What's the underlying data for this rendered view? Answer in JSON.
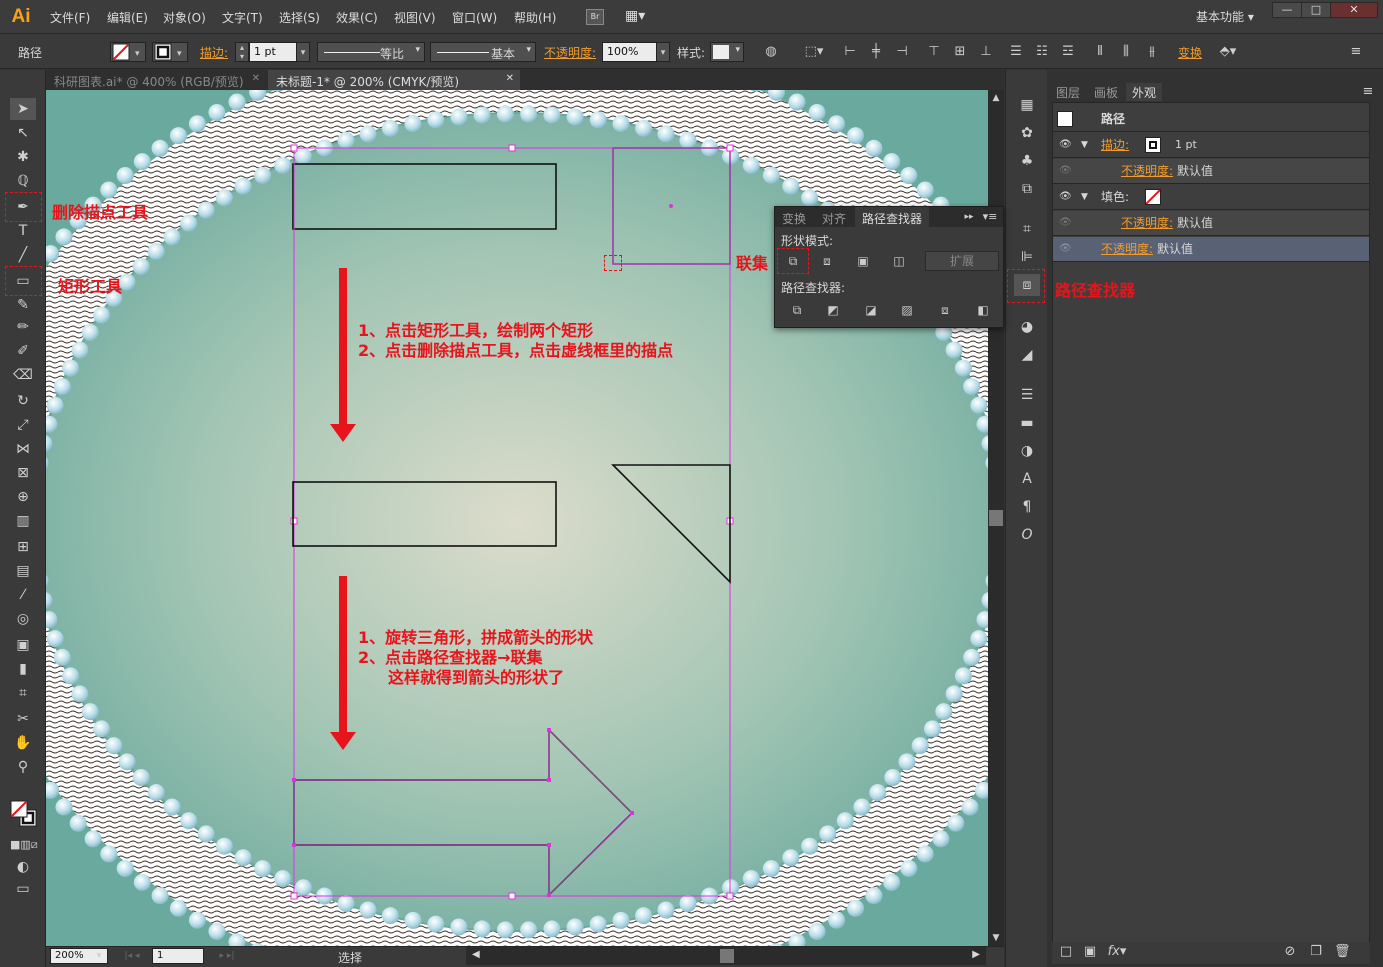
{
  "app": {
    "logo": "Ai",
    "bridge": "Br",
    "workspace": "基本功能 ▾"
  },
  "menu": [
    "文件(F)",
    "编辑(E)",
    "对象(O)",
    "文字(T)",
    "选择(S)",
    "效果(C)",
    "视图(V)",
    "窗口(W)",
    "帮助(H)"
  ],
  "window_controls": {
    "minimize": "—",
    "maximize": "□",
    "close": "✕"
  },
  "control": {
    "object_type": "路径",
    "stroke_label": "描边:",
    "stroke_value": "1 pt",
    "profile": "等比",
    "brush": "基本",
    "opacity_label": "不透明度:",
    "opacity_value": "100%",
    "style_label": "样式:",
    "transform_label": "变换"
  },
  "doc_tabs": [
    {
      "label": "科研图表.ai* @ 400% (RGB/预览)",
      "close": "✕"
    },
    {
      "label": "未标题-1* @ 200% (CMYK/预览)",
      "close": "✕"
    }
  ],
  "status": {
    "zoom": "200%",
    "page": "1",
    "tool": "选择"
  },
  "pathfinder": {
    "tabs": [
      "变换",
      "对齐",
      "路径查找器"
    ],
    "shape_modes_label": "形状模式:",
    "expand_label": "扩展",
    "pathfinders_label": "路径查找器:"
  },
  "appearance": {
    "tabs": [
      "图层",
      "画板",
      "外观"
    ],
    "title": "路径",
    "rows": [
      {
        "label": "描边:",
        "value": "1 pt"
      },
      {
        "label": "不透明度:",
        "value": "默认值"
      },
      {
        "label": "填色:",
        "value": ""
      },
      {
        "label": "不透明度:",
        "value": "默认值"
      },
      {
        "label": "不透明度:",
        "value": "默认值"
      }
    ]
  },
  "annotations": {
    "delete_anchor_tool": "删除描点工具",
    "rect_tool": "矩形工具",
    "unite": "联集",
    "pathfinder": "路径查找器",
    "step1_a": "1、点击矩形工具，绘制两个矩形",
    "step1_b": "2、点击删除描点工具，点击虚线框里的描点",
    "step2_a": "1、旋转三角形，拼成箭头的形状",
    "step2_b": "2、点击路径查找器→联集",
    "step2_c": "这样就得到箭头的形状了"
  },
  "colors": {
    "annotation": "#e8141c",
    "selection": "#e030e0",
    "canvas_bg": "#6aa99d",
    "accent_orange": "#f39c2b"
  }
}
